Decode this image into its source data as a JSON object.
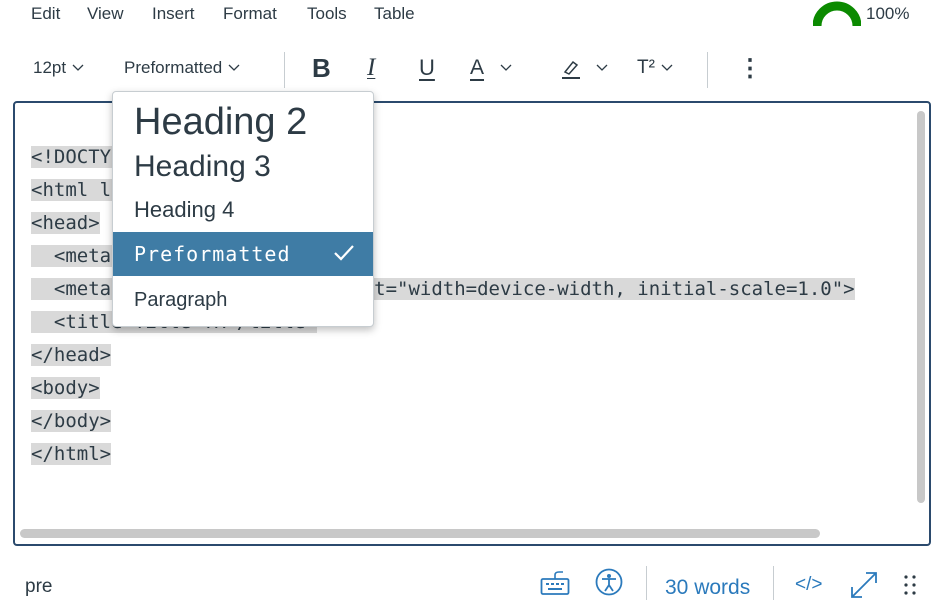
{
  "menubar": {
    "items": [
      "Edit",
      "View",
      "Insert",
      "Format",
      "Tools",
      "Table"
    ],
    "score": "100%",
    "score_color": "#0b8a00"
  },
  "toolbar": {
    "font_size": "12pt",
    "block_format": "Preformatted",
    "bold": "B",
    "italic": "I",
    "underline": "U",
    "text_color": "A",
    "superscript": "T²",
    "more": "⋮"
  },
  "editor": {
    "lines": [
      "<!DOCTYPE html>",
      "<html lang=\"en\">",
      "<head>",
      "  <meta charset=\"UTF-8\">",
      "  <meta name=\"viewport\" content=\"width=device-width, initial-scale=1.0\">",
      "  <title>Title TR</title>",
      "</head>",
      "<body>",
      "</body>",
      "</html>"
    ]
  },
  "dropdown": {
    "items": [
      {
        "label": "Heading 2"
      },
      {
        "label": "Heading 3"
      },
      {
        "label": "Heading 4"
      },
      {
        "label": "Preformatted",
        "selected": true
      },
      {
        "label": "Paragraph"
      }
    ],
    "highlight_color": "#3f7ca5"
  },
  "statusbar": {
    "path": "pre",
    "word_count": "30 words",
    "html_toggle": "</>"
  },
  "colors": {
    "accent": "#2b7abc",
    "editor_border": "#2b4a6d",
    "code_highlight": "#d9d9d9"
  }
}
